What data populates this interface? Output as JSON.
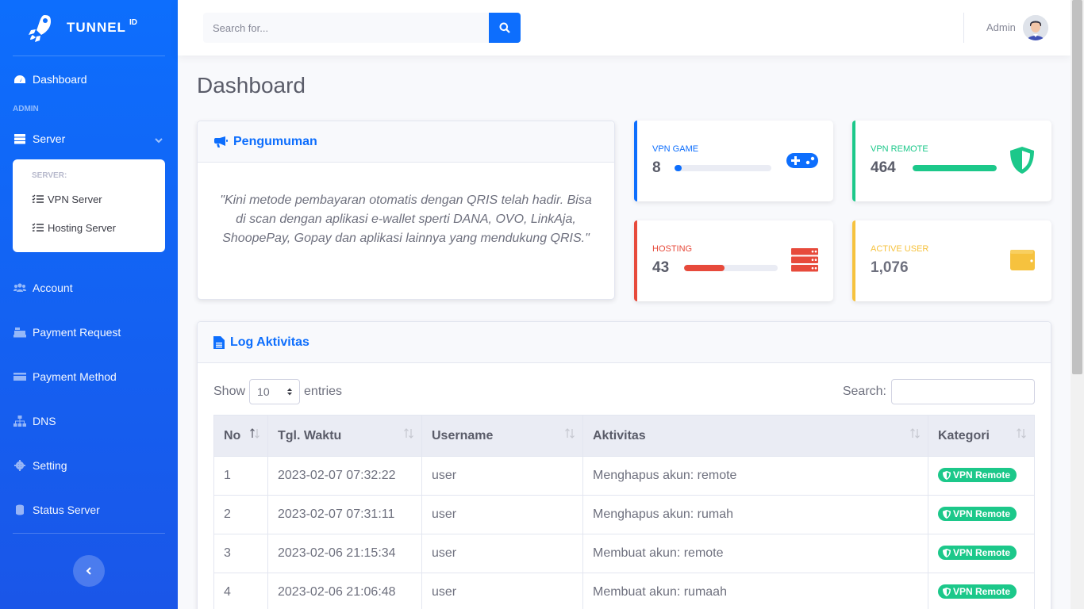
{
  "brand": {
    "name": "TUNNEL",
    "sup": "ID"
  },
  "sidebar": {
    "dashboard": "Dashboard",
    "heading_admin": "ADMIN",
    "server": "Server",
    "collapse_heading": "SERVER:",
    "vpn_server": "VPN Server",
    "hosting_server": "Hosting Server",
    "account": "Account",
    "payment_request": "Payment Request",
    "payment_method": "Payment Method",
    "dns": "DNS",
    "setting": "Setting",
    "status_server": "Status Server"
  },
  "topbar": {
    "search_placeholder": "Search for...",
    "user_name": "Admin"
  },
  "page": {
    "title": "Dashboard"
  },
  "announcement": {
    "title": "Pengumuman",
    "text": "\"Kini metode pembayaran otomatis dengan QRIS telah hadir. Bisa di scan dengan aplikasi e-wallet sperti DANA, OVO, LinkAja, ShoopePay, Gopay dan aplikasi lainnya yang mendukung QRIS.\""
  },
  "stats": {
    "vpn_game": {
      "label": "VPN GAME",
      "value": "8",
      "progress": 0.07,
      "color": "#0d6efd"
    },
    "vpn_remote": {
      "label": "VPN REMOTE",
      "value": "464",
      "progress": 1.0,
      "color": "#1cc88a"
    },
    "hosting": {
      "label": "HOSTING",
      "value": "43",
      "progress": 0.43,
      "color": "#e74a3b"
    },
    "active_user": {
      "label": "ACTIVE USER",
      "value": "1,076",
      "color": "#f6c23e"
    }
  },
  "log": {
    "title": "Log Aktivitas",
    "show_label": "Show",
    "entries_value": "10",
    "entries_label": "entries",
    "search_label": "Search:",
    "columns": [
      "No",
      "Tgl. Waktu",
      "Username",
      "Aktivitas",
      "Kategori"
    ],
    "rows": [
      {
        "no": "1",
        "time": "2023-02-07 07:32:22",
        "user": "user",
        "activity": "Menghapus akun: remote",
        "category": "VPN Remote"
      },
      {
        "no": "2",
        "time": "2023-02-07 07:31:11",
        "user": "user",
        "activity": "Menghapus akun: rumah",
        "category": "VPN Remote"
      },
      {
        "no": "3",
        "time": "2023-02-06 21:15:34",
        "user": "user",
        "activity": "Membuat akun: remote",
        "category": "VPN Remote"
      },
      {
        "no": "4",
        "time": "2023-02-06 21:06:48",
        "user": "user",
        "activity": "Membuat akun: rumaah",
        "category": "VPN Remote"
      }
    ]
  }
}
